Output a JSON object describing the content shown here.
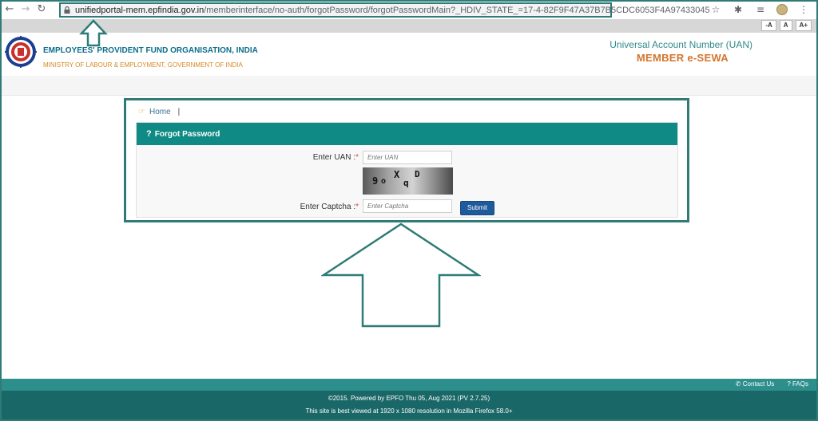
{
  "browser": {
    "url_domain": "unifiedportal-mem.epfindia.gov.in",
    "url_path": "/memberinterface/no-auth/forgotPassword/forgotPasswordMain?_HDIV_STATE_=17-4-82F9F47A37B7B5CDC6053F4A97433045"
  },
  "accessibility": {
    "decrease": "-A",
    "normal": "A",
    "increase": "A+"
  },
  "header": {
    "org_name": "EMPLOYEES' PROVIDENT FUND ORGANISATION, INDIA",
    "ministry": "MINISTRY OF LABOUR & EMPLOYMENT, GOVERNMENT OF INDIA",
    "uan_title": "Universal Account Number (UAN)",
    "sewa_title": "MEMBER e-SEWA"
  },
  "breadcrumb": {
    "home": "Home",
    "separator": "|"
  },
  "form": {
    "title": "Forgot Password",
    "uan_label": "Enter UAN :",
    "uan_placeholder": "Enter UAN",
    "captcha_label": "Enter Captcha :",
    "captcha_placeholder": "Enter Captcha",
    "required_mark": "*",
    "captcha_chars": [
      "9",
      "o",
      "X",
      "q",
      "D"
    ],
    "submit_label": "Submit"
  },
  "footer": {
    "contact": "Contact Us",
    "faqs": "FAQs",
    "copyright": "©2015. Powered by EPFO Thu 05, Aug 2021 (PV 2.7.25)",
    "best_view": "This site is best viewed at 1920 x 1080 resolution in Mozilla Firefox 58.0+"
  },
  "colors": {
    "highlight": "#2e7b78",
    "panel_header": "#0f8a84",
    "footer": "#1a6767",
    "submit": "#1f5a9a",
    "accent_orange": "#d4742c"
  }
}
